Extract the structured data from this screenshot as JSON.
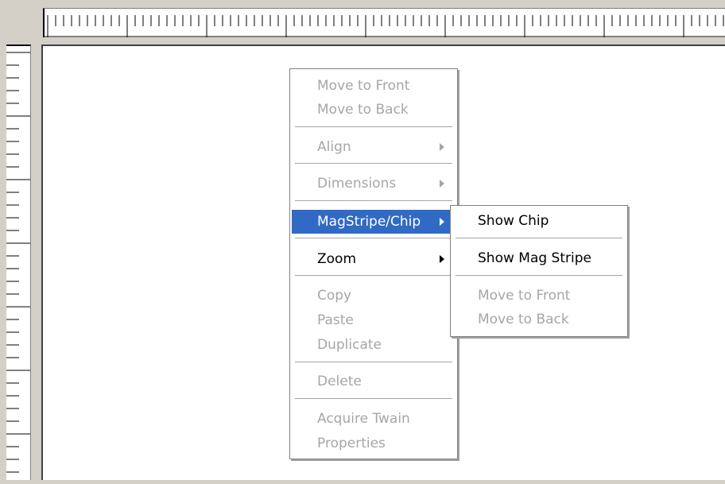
{
  "context_menu": {
    "items": [
      {
        "label": "Move to Front"
      },
      {
        "label": "Move to Back"
      },
      {
        "label": "Align"
      },
      {
        "label": "Dimensions"
      },
      {
        "label": "MagStripe/Chip"
      },
      {
        "label": "Zoom"
      },
      {
        "label": "Copy"
      },
      {
        "label": "Paste"
      },
      {
        "label": "Duplicate"
      },
      {
        "label": "Delete"
      },
      {
        "label": "Acquire Twain"
      },
      {
        "label": "Properties"
      }
    ]
  },
  "submenu": {
    "items": [
      {
        "label": "Show Chip"
      },
      {
        "label": "Show Mag Stripe"
      },
      {
        "label": "Move to Front"
      },
      {
        "label": "Move to Back"
      }
    ]
  },
  "colors": {
    "highlight": "#316ac5",
    "disabled_text": "#a6a6a6",
    "chrome": "#d4d0c8"
  }
}
